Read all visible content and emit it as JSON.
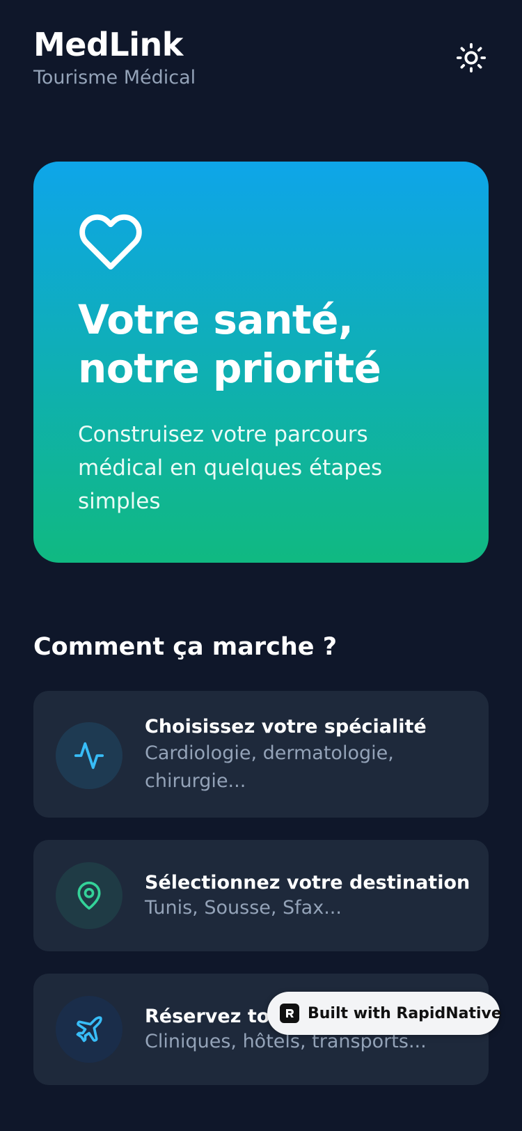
{
  "header": {
    "title": "MedLink",
    "subtitle": "Tourisme Médical",
    "theme_toggle_icon": "sun-icon"
  },
  "hero": {
    "icon": "heart-icon",
    "title_line1": "Votre santé,",
    "title_line2": "notre priorité",
    "text": "Construisez votre parcours médical en quelques étapes simples",
    "gradient_top": "#0ea5e9",
    "gradient_bottom": "#10b981"
  },
  "how_it_works": {
    "title": "Comment ça marche ?",
    "steps": [
      {
        "icon": "activity-icon",
        "icon_color": "#38bdf8",
        "title": "Choisissez votre spécialité",
        "description": "Cardiologie, dermatologie, chirurgie..."
      },
      {
        "icon": "map-pin-icon",
        "icon_color": "#34d399",
        "title": "Sélectionnez votre destination",
        "description": "Tunis, Sousse, Sfax..."
      },
      {
        "icon": "plane-icon",
        "icon_color": "#38bdf8",
        "title": "Réservez tou",
        "description": "Cliniques, hôtels, transports..."
      }
    ]
  },
  "badge": {
    "label": "Built with RapidNative"
  },
  "colors": {
    "background": "#0f172a",
    "card": "#1e293b",
    "muted_text": "#94a3b8"
  }
}
